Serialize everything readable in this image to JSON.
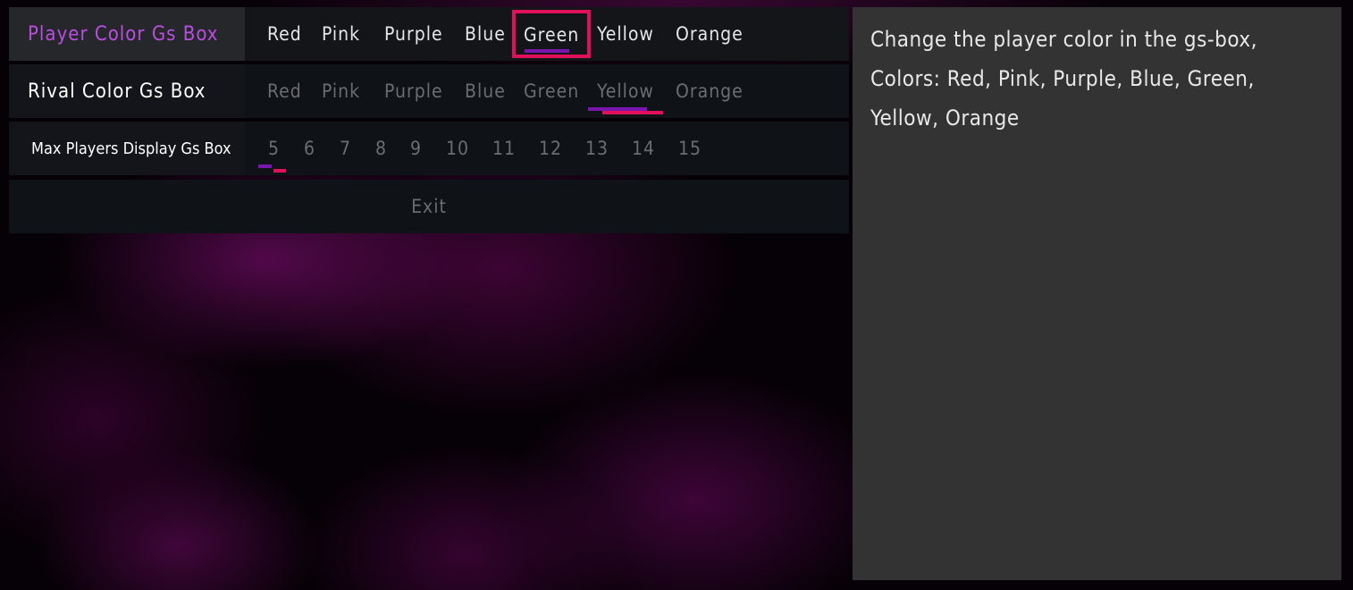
{
  "menu": {
    "rows": [
      {
        "label": "Player Color Gs Box",
        "options": [
          "Red",
          "Pink",
          "Purple",
          "Blue",
          "Green",
          "Yellow",
          "Orange"
        ],
        "selected": "Green"
      },
      {
        "label": "Rival Color Gs Box",
        "options": [
          "Red",
          "Pink",
          "Purple",
          "Blue",
          "Green",
          "Yellow",
          "Orange"
        ],
        "selected": "Yellow"
      },
      {
        "label": "Max Players Display Gs Box",
        "options": [
          "5",
          "6",
          "7",
          "8",
          "9",
          "10",
          "11",
          "12",
          "13",
          "14",
          "15"
        ],
        "selected": "5"
      }
    ],
    "exit_label": "Exit"
  },
  "description": {
    "text": "Change the player color in the gs-box, Colors: Red, Pink, Purple, Blue, Green, Yellow, Orange"
  },
  "colors": {
    "highlight": "#e0105a",
    "accent_purple": "#7a16b0",
    "active_label": "#b94ee0",
    "panel": "#333333"
  }
}
